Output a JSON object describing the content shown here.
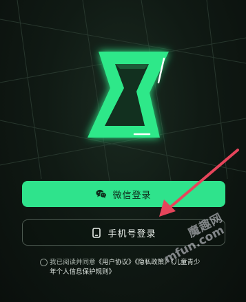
{
  "login": {
    "wechat_label": "微信登录",
    "phone_label": "手机号登录"
  },
  "agreement": {
    "line1_prefix": "我已阅读并同意",
    "user_agreement": "《用户协议》",
    "privacy_policy": "《隐私政策》",
    "children_policy_part1": "《儿童青少",
    "children_policy_part2": "年个人信息保护规则》"
  },
  "watermark": {
    "cn": "魔趣网",
    "url": "mfun.com"
  },
  "colors": {
    "accent": "#2fe38c",
    "logo_green": "#2ee889",
    "background": "#0c110e",
    "arrow": "#e6455b"
  },
  "icons": {
    "wechat": "wechat-icon",
    "phone": "phone-icon",
    "logo": "app-logo"
  }
}
